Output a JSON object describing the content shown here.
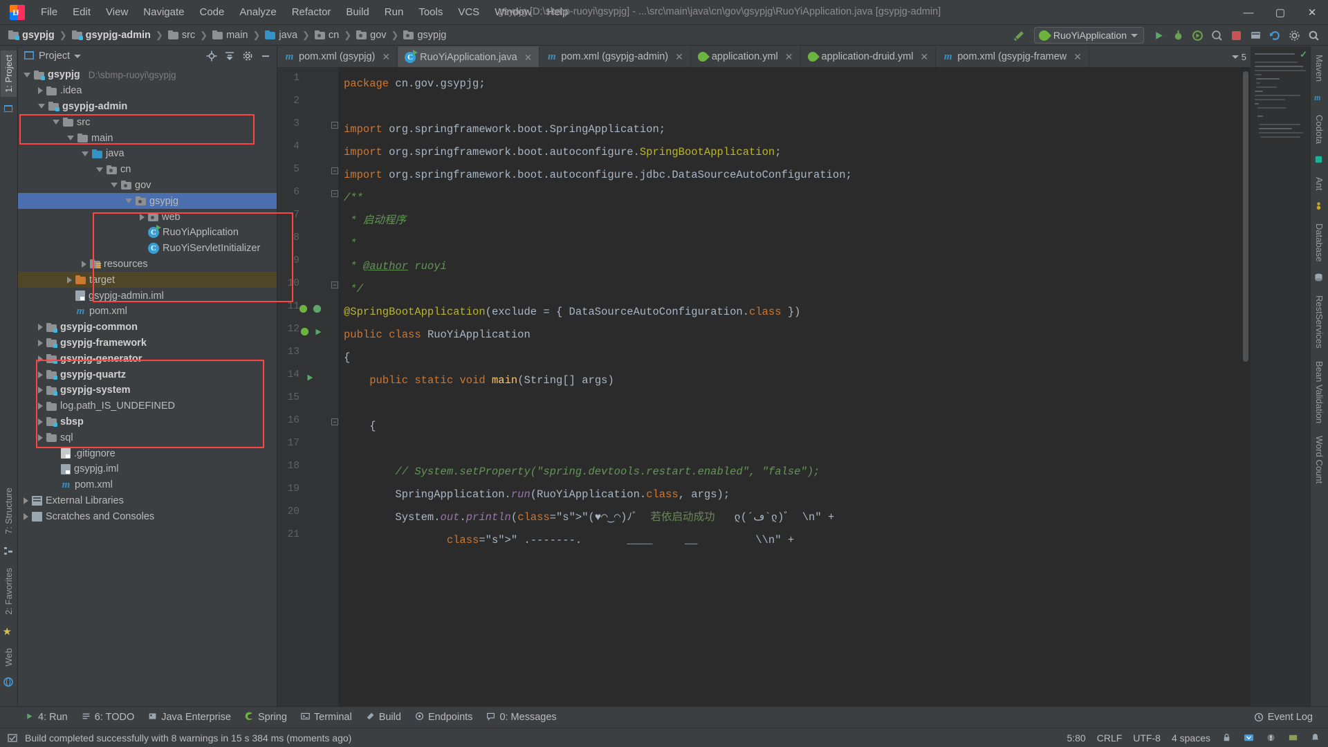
{
  "window": {
    "title": "gsypjg [D:\\sbmp-ruoyi\\gsypjg] - ...\\src\\main\\java\\cn\\gov\\gsypjg\\RuoYiApplication.java [gsypjg-admin]",
    "minimize": "—",
    "maximize": "▢",
    "close": "✕",
    "logo_letters": "IJ"
  },
  "menu": [
    {
      "label": "File"
    },
    {
      "label": "Edit"
    },
    {
      "label": "View"
    },
    {
      "label": "Navigate"
    },
    {
      "label": "Code"
    },
    {
      "label": "Analyze"
    },
    {
      "label": "Refactor"
    },
    {
      "label": "Build"
    },
    {
      "label": "Run"
    },
    {
      "label": "Tools"
    },
    {
      "label": "VCS"
    },
    {
      "label": "Window"
    },
    {
      "label": "Help"
    }
  ],
  "breadcrumb": [
    {
      "label": "gsypjg",
      "icon": "module-folder-icon",
      "bold": true
    },
    {
      "label": "gsypjg-admin",
      "icon": "module-folder-icon",
      "bold": true
    },
    {
      "label": "src",
      "icon": "folder-icon",
      "bold": false
    },
    {
      "label": "main",
      "icon": "folder-icon",
      "bold": false
    },
    {
      "label": "java",
      "icon": "source-folder-icon",
      "bold": false
    },
    {
      "label": "cn",
      "icon": "package-icon",
      "bold": false
    },
    {
      "label": "gov",
      "icon": "package-icon",
      "bold": false
    },
    {
      "label": "gsypjg",
      "icon": "package-icon",
      "bold": false
    }
  ],
  "toolbar": {
    "run_config_label": "RuoYiApplication",
    "build_hammer": "build-icon",
    "buttons": [
      "run-icon",
      "debug-icon",
      "run-with-coverage-icon",
      "profile-icon",
      "stop-icon",
      "build-project-icon",
      "update-icon",
      "settings-icon",
      "search-icon"
    ]
  },
  "project_panel": {
    "title": "Project",
    "header_icons": [
      "locate-icon",
      "collapse-all-icon",
      "settings-gear-icon",
      "hide-icon"
    ],
    "tree": [
      {
        "depth": 0,
        "label": "gsypjg",
        "path": "D:\\sbmp-ruoyi\\gsypjg",
        "icon": "module-folder-icon",
        "arrow": "down",
        "bold": true
      },
      {
        "depth": 1,
        "label": ".idea",
        "icon": "folder-icon",
        "arrow": "right",
        "bold": false
      },
      {
        "depth": 1,
        "label": "gsypjg-admin",
        "icon": "module-folder-icon",
        "arrow": "down",
        "bold": true
      },
      {
        "depth": 2,
        "label": "src",
        "icon": "folder-icon",
        "arrow": "down",
        "bold": false
      },
      {
        "depth": 3,
        "label": "main",
        "icon": "folder-icon",
        "arrow": "down",
        "bold": false
      },
      {
        "depth": 4,
        "label": "java",
        "icon": "source-folder-icon",
        "arrow": "down",
        "bold": false
      },
      {
        "depth": 5,
        "label": "cn",
        "icon": "package-icon",
        "arrow": "down",
        "bold": false
      },
      {
        "depth": 6,
        "label": "gov",
        "icon": "package-icon",
        "arrow": "down",
        "bold": false
      },
      {
        "depth": 7,
        "label": "gsypjg",
        "icon": "package-icon",
        "arrow": "down",
        "bold": false,
        "selected": true
      },
      {
        "depth": 8,
        "label": "web",
        "icon": "package-icon",
        "arrow": "right",
        "bold": false
      },
      {
        "depth": 8,
        "label": "RuoYiApplication",
        "icon": "java-class-runnable-icon",
        "arrow": "none",
        "bold": false
      },
      {
        "depth": 8,
        "label": "RuoYiServletInitializer",
        "icon": "java-class-icon",
        "arrow": "none",
        "bold": false
      },
      {
        "depth": 4,
        "label": "resources",
        "icon": "resources-folder-icon",
        "arrow": "right",
        "bold": false
      },
      {
        "depth": 3,
        "label": "target",
        "icon": "excluded-folder-icon",
        "arrow": "right",
        "bold": false,
        "highlight": true
      },
      {
        "depth": 3,
        "label": "gsypjg-admin.iml",
        "icon": "iml-file-icon",
        "arrow": "none",
        "bold": false
      },
      {
        "depth": 3,
        "label": "pom.xml",
        "icon": "maven-file-icon",
        "arrow": "none",
        "bold": false
      },
      {
        "depth": 1,
        "label": "gsypjg-common",
        "icon": "module-folder-icon",
        "arrow": "right",
        "bold": true
      },
      {
        "depth": 1,
        "label": "gsypjg-framework",
        "icon": "module-folder-icon",
        "arrow": "right",
        "bold": true
      },
      {
        "depth": 1,
        "label": "gsypjg-generator",
        "icon": "module-folder-icon",
        "arrow": "right",
        "bold": true
      },
      {
        "depth": 1,
        "label": "gsypjg-quartz",
        "icon": "module-folder-icon",
        "arrow": "right",
        "bold": true
      },
      {
        "depth": 1,
        "label": "gsypjg-system",
        "icon": "module-folder-icon",
        "arrow": "right",
        "bold": true
      },
      {
        "depth": 1,
        "label": "log.path_IS_UNDEFINED",
        "icon": "folder-icon",
        "arrow": "right",
        "bold": false
      },
      {
        "depth": 1,
        "label": "sbsp",
        "icon": "module-folder-icon",
        "arrow": "right",
        "bold": true
      },
      {
        "depth": 1,
        "label": "sql",
        "icon": "folder-icon",
        "arrow": "right",
        "bold": false
      },
      {
        "depth": 2,
        "label": ".gitignore",
        "icon": "git-file-icon",
        "arrow": "none",
        "bold": false
      },
      {
        "depth": 2,
        "label": "gsypjg.iml",
        "icon": "iml-file-icon",
        "arrow": "none",
        "bold": false
      },
      {
        "depth": 2,
        "label": "pom.xml",
        "icon": "maven-file-icon",
        "arrow": "none",
        "bold": false
      },
      {
        "depth": 0,
        "label": "External Libraries",
        "icon": "libraries-icon",
        "arrow": "right",
        "bold": false
      },
      {
        "depth": 0,
        "label": "Scratches and Consoles",
        "icon": "scratches-icon",
        "arrow": "right",
        "bold": false
      }
    ]
  },
  "editor_tabs": [
    {
      "label": "pom.xml (gsypjg)",
      "icon": "maven-file-icon",
      "active": false
    },
    {
      "label": "RuoYiApplication.java",
      "icon": "java-class-runnable-icon",
      "active": true
    },
    {
      "label": "pom.xml (gsypjg-admin)",
      "icon": "maven-file-icon",
      "active": false
    },
    {
      "label": "application.yml",
      "icon": "spring-yaml-icon",
      "active": false
    },
    {
      "label": "application-druid.yml",
      "icon": "spring-yaml-icon",
      "active": false
    },
    {
      "label": "pom.xml (gsypjg-framew",
      "icon": "maven-file-icon",
      "active": false
    }
  ],
  "tab_overflow_count": "5",
  "code": {
    "line_numbers": [
      "1",
      "2",
      "3",
      "4",
      "5",
      "6",
      "7",
      "8",
      "9",
      "10",
      "11",
      "12",
      "13",
      "14",
      "15",
      "16",
      "17",
      "18",
      "19",
      "20",
      "21"
    ],
    "lines": [
      "package cn.gov.gsypjg;",
      "",
      "import org.springframework.boot.SpringApplication;",
      "import org.springframework.boot.autoconfigure.SpringBootApplication;",
      "import org.springframework.boot.autoconfigure.jdbc.DataSourceAutoConfiguration;",
      "/**",
      " * 启动程序",
      " *",
      " * @author ruoyi",
      " */",
      "@SpringBootApplication(exclude = { DataSourceAutoConfiguration.class })",
      "public class RuoYiApplication",
      "{",
      "    public static void main(String[] args)",
      "",
      "    {",
      "",
      "        // System.setProperty(\"spring.devtools.restart.enabled\", \"false\");",
      "        SpringApplication.run(RuoYiApplication.class, args);",
      "        System.out.println(\"(♥◠‿◠)ﾉﾞ  若依启动成功   ლ(´ڡ`ლ)ﾞ  \\n\" +",
      "                \" .-------.       ____     __         \\\\n\" +"
    ],
    "inspection_status": "ok"
  },
  "bottom_tool_buttons": [
    {
      "label": "4: Run",
      "icon": "run-icon"
    },
    {
      "label": "6: TODO",
      "icon": "todo-icon"
    },
    {
      "label": "Java Enterprise",
      "icon": "java-enterprise-icon"
    },
    {
      "label": "Spring",
      "icon": "spring-icon"
    },
    {
      "label": "Terminal",
      "icon": "terminal-icon"
    },
    {
      "label": "Build",
      "icon": "build-icon"
    },
    {
      "label": "Endpoints",
      "icon": "endpoints-icon"
    },
    {
      "label": "0: Messages",
      "icon": "messages-icon"
    }
  ],
  "event_log_label": "Event Log",
  "left_rail": [
    {
      "label": "1: Project",
      "active": true
    },
    {
      "label": "7: Structure",
      "active": false
    },
    {
      "label": "2: Favorites",
      "active": false
    },
    {
      "label": "Web",
      "active": false
    }
  ],
  "right_rail": [
    {
      "label": "Maven"
    },
    {
      "label": "Codota"
    },
    {
      "label": "Ant"
    },
    {
      "label": "Database"
    },
    {
      "label": "RestServices"
    },
    {
      "label": "Bean Validation"
    },
    {
      "label": "Word Count"
    }
  ],
  "status_bar": {
    "message": "Build completed successfully with 8 warnings in 15 s 384 ms (moments ago)",
    "caret": "5:80",
    "line_separator": "CRLF",
    "encoding": "UTF-8",
    "indent": "4 spaces",
    "icons": [
      "lock-icon",
      "git-branch-icon",
      "inspection-icon",
      "memory-icon",
      "notifications-icon"
    ]
  },
  "colors": {
    "accent_blue": "#4b6eaf",
    "highlight_red": "#ff4444",
    "bg_panel": "#3c3f41",
    "bg_editor": "#2b2b2b",
    "green": "#59a869"
  }
}
